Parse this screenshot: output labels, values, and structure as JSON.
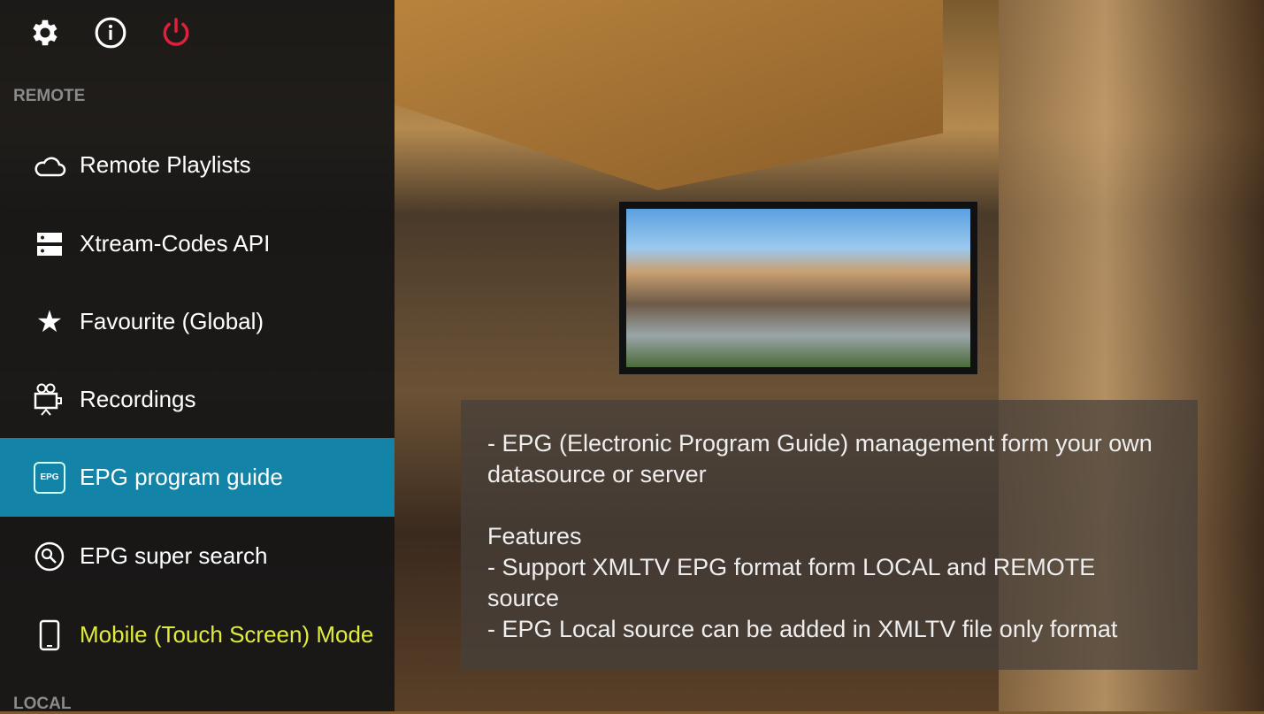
{
  "toolbar": {
    "icons": [
      "gear-icon",
      "info-icon",
      "power-icon"
    ],
    "power_color": "#e0203c"
  },
  "sidebar": {
    "section_remote": "REMOTE",
    "section_local": "LOCAL",
    "items": [
      {
        "label": "Remote Playlists",
        "icon": "cloud-icon"
      },
      {
        "label": "Xtream-Codes API",
        "icon": "server-icon"
      },
      {
        "label": "Favourite (Global)",
        "icon": "star-icon"
      },
      {
        "label": "Recordings",
        "icon": "movie-camera-icon"
      },
      {
        "label": "EPG program guide",
        "icon": "epg-icon",
        "selected": true,
        "badge": "EPG"
      },
      {
        "label": "EPG super search",
        "icon": "search-icon"
      },
      {
        "label": "Mobile (Touch Screen) Mode",
        "icon": "phone-icon",
        "color": "#e0ec3c"
      }
    ],
    "selected_color": "#1384a7"
  },
  "description": {
    "text": "- EPG (Electronic Program Guide) management form your own datasource or server\n\nFeatures\n- Support XMLTV EPG format form LOCAL and REMOTE source\n- EPG Local source can be added in XMLTV file only format"
  }
}
